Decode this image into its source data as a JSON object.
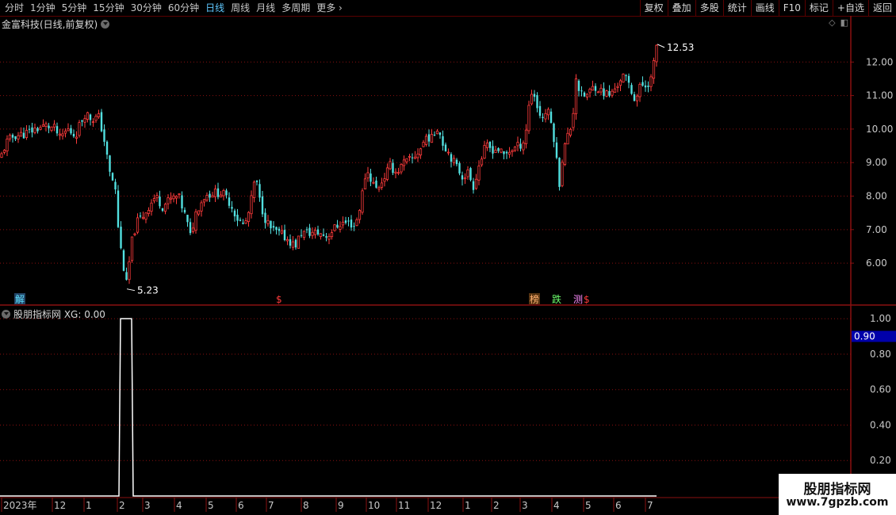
{
  "toolbar": {
    "periods": [
      "分时",
      "1分钟",
      "5分钟",
      "15分钟",
      "30分钟",
      "60分钟",
      "日线",
      "周线",
      "月线",
      "多周期",
      "更多"
    ],
    "active_period": "日线",
    "actions": [
      "复权",
      "叠加",
      "多股",
      "统计",
      "画线",
      "F10",
      "标记",
      "+自选",
      "返回"
    ]
  },
  "main_title": "金富科技(日线,前复权)",
  "indicator_title": "股朋指标网 XG: 0.00",
  "colors": {
    "up": "#ff3b3b",
    "down": "#52e0e0",
    "grid": "#8a1010",
    "indicator_line": "#ffffff",
    "highlight_box": "#0000aa"
  },
  "chart_data": [
    {
      "type": "candlestick",
      "y_axis": {
        "ticks": [
          "12.00",
          "11.00",
          "10.00",
          "9.00",
          "8.00",
          "7.00",
          "6.00"
        ],
        "range": [
          4.75,
          13.0
        ]
      },
      "x_labels": [
        "2023年",
        "12",
        "1",
        "2",
        "3",
        "4",
        "5",
        "6",
        "7",
        "8",
        "9",
        "10",
        "11",
        "12",
        "1",
        "2",
        "3",
        "4",
        "5",
        "6",
        "7"
      ],
      "annotations": {
        "high": "12.53",
        "low": "5.23"
      },
      "markers": [
        "解",
        "$",
        "榜",
        "跌",
        "测",
        "$"
      ],
      "close_path": [
        [
          0,
          9.1
        ],
        [
          8,
          9.6
        ],
        [
          18,
          9.8
        ],
        [
          30,
          9.85
        ],
        [
          45,
          10.0
        ],
        [
          58,
          10.1
        ],
        [
          70,
          10.0
        ],
        [
          75,
          9.7
        ],
        [
          85,
          10.0
        ],
        [
          95,
          9.8
        ],
        [
          100,
          10.1
        ],
        [
          108,
          10.5
        ],
        [
          115,
          10.3
        ],
        [
          125,
          10.35
        ],
        [
          132,
          9.6
        ],
        [
          138,
          8.7
        ],
        [
          145,
          8.3
        ],
        [
          150,
          6.8
        ],
        [
          155,
          6.0
        ],
        [
          160,
          5.3
        ],
        [
          165,
          6.5
        ],
        [
          172,
          7.2
        ],
        [
          180,
          7.4
        ],
        [
          188,
          7.7
        ],
        [
          196,
          8.0
        ],
        [
          205,
          7.7
        ],
        [
          215,
          7.9
        ],
        [
          225,
          8.0
        ],
        [
          235,
          7.3
        ],
        [
          240,
          6.8
        ],
        [
          248,
          7.6
        ],
        [
          258,
          8.0
        ],
        [
          268,
          8.1
        ],
        [
          280,
          8.1
        ],
        [
          290,
          7.8
        ],
        [
          300,
          7.3
        ],
        [
          308,
          7.1
        ],
        [
          315,
          7.6
        ],
        [
          322,
          8.6
        ],
        [
          328,
          7.8
        ],
        [
          335,
          7.3
        ],
        [
          342,
          7.0
        ],
        [
          350,
          6.9
        ],
        [
          358,
          6.8
        ],
        [
          368,
          6.6
        ],
        [
          372,
          6.5
        ],
        [
          380,
          6.9
        ],
        [
          392,
          6.9
        ],
        [
          402,
          6.9
        ],
        [
          412,
          6.8
        ],
        [
          420,
          7.0
        ],
        [
          430,
          7.2
        ],
        [
          440,
          7.2
        ],
        [
          448,
          7.1
        ],
        [
          455,
          7.8
        ],
        [
          462,
          8.8
        ],
        [
          468,
          8.5
        ],
        [
          475,
          8.2
        ],
        [
          483,
          8.5
        ],
        [
          492,
          8.9
        ],
        [
          500,
          8.7
        ],
        [
          510,
          9.0
        ],
        [
          520,
          9.1
        ],
        [
          530,
          9.4
        ],
        [
          538,
          9.8
        ],
        [
          545,
          9.7
        ],
        [
          552,
          10.1
        ],
        [
          558,
          9.6
        ],
        [
          566,
          9.3
        ],
        [
          575,
          8.9
        ],
        [
          583,
          8.6
        ],
        [
          590,
          8.7
        ],
        [
          597,
          8.3
        ],
        [
          605,
          9.0
        ],
        [
          613,
          9.5
        ],
        [
          620,
          9.4
        ],
        [
          628,
          9.4
        ],
        [
          635,
          9.2
        ],
        [
          645,
          9.4
        ],
        [
          655,
          9.5
        ],
        [
          662,
          9.7
        ],
        [
          668,
          10.9
        ],
        [
          672,
          11.2
        ],
        [
          678,
          10.6
        ],
        [
          684,
          10.3
        ],
        [
          690,
          10.6
        ],
        [
          697,
          10.0
        ],
        [
          701,
          9.3
        ],
        [
          705,
          8.3
        ],
        [
          710,
          9.3
        ],
        [
          716,
          9.8
        ],
        [
          722,
          10.2
        ],
        [
          726,
          11.6
        ],
        [
          732,
          11.0
        ],
        [
          740,
          11.0
        ],
        [
          750,
          11.3
        ],
        [
          760,
          11.1
        ],
        [
          770,
          11.0
        ],
        [
          778,
          11.3
        ],
        [
          785,
          11.6
        ],
        [
          792,
          11.4
        ],
        [
          798,
          11.0
        ],
        [
          802,
          10.9
        ],
        [
          808,
          11.3
        ],
        [
          815,
          11.3
        ],
        [
          821,
          11.5
        ],
        [
          825,
          12.0
        ],
        [
          828,
          12.5
        ]
      ]
    },
    {
      "type": "line",
      "name": "XG",
      "y_axis": {
        "ticks": [
          "1.00",
          "0.80",
          "0.60",
          "0.40",
          "0.20"
        ],
        "range": [
          0,
          1.05
        ]
      },
      "highlight_value": "0.90",
      "x": [
        0,
        150,
        152,
        166,
        168,
        828
      ],
      "values": [
        0,
        0,
        1,
        1,
        0,
        0
      ]
    }
  ],
  "watermark": {
    "name": "股朋指标网",
    "url": "www.7gpzb.com"
  }
}
